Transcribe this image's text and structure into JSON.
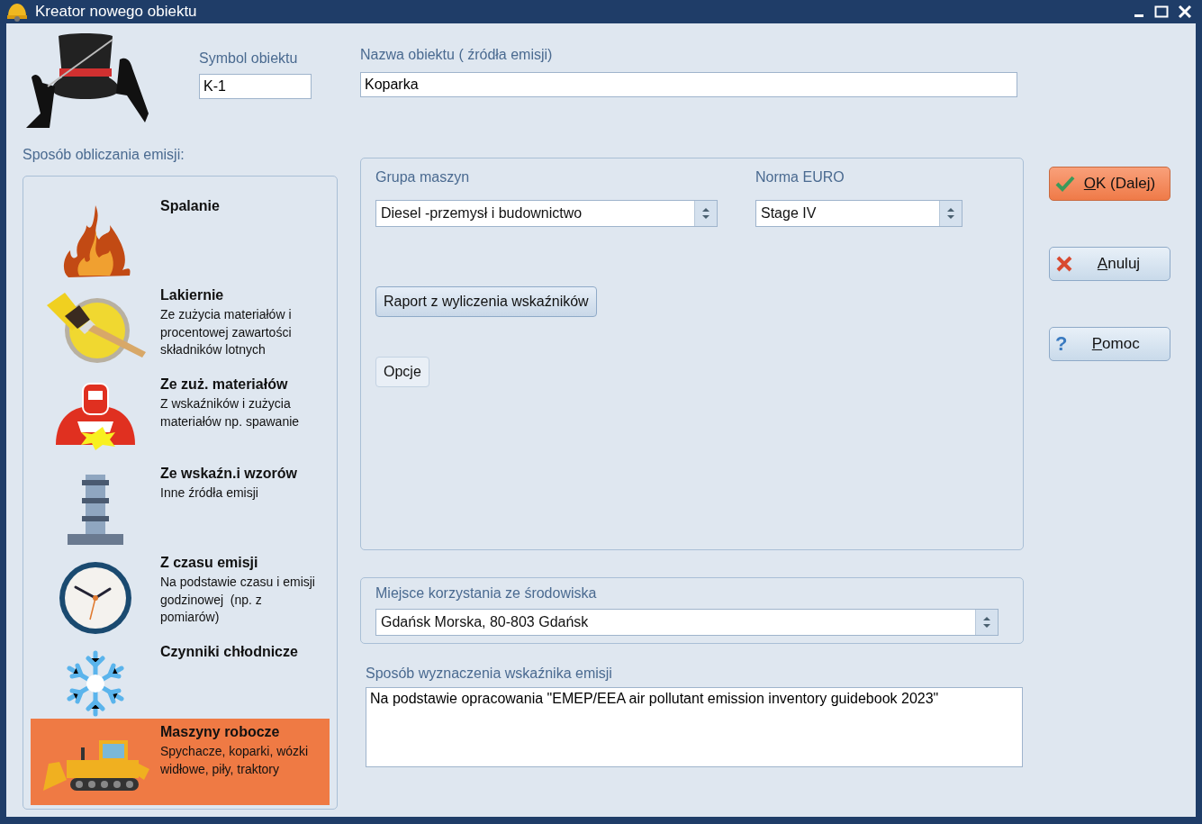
{
  "window": {
    "title": "Kreator nowego obiektu"
  },
  "symbol_field": {
    "label": "Symbol obiektu",
    "value": "K-1"
  },
  "name_field": {
    "label": "Nazwa obiektu ( źródła emisji)",
    "value": "Koparka"
  },
  "methods_label": "Sposób obliczania emisji:",
  "methods": [
    {
      "kind": "flame",
      "title": "Spalanie",
      "selected": false
    },
    {
      "kind": "brush",
      "title": "Lakiernie",
      "description": "Ze zużycia materiałów i procentowej zawartości składników lotnych",
      "selected": false
    },
    {
      "kind": "welder",
      "title": "Ze zuż. materiałów",
      "description": "Z wskaźników i zużycia materiałów np. spawanie",
      "selected": false
    },
    {
      "kind": "tower",
      "title": "Ze wskaźn.i wzorów",
      "description": "Inne źródła emisji",
      "selected": false
    },
    {
      "kind": "clock",
      "title": "Z czasu emisji",
      "description": "Na podstawie czasu i emisji godzinowej  (np. z pomiarów)",
      "selected": false
    },
    {
      "kind": "snowflake",
      "title": "Czynniki chłodnicze",
      "selected": false
    },
    {
      "kind": "bulldozer",
      "title": "Maszyny robocze",
      "description": "Spychacze, koparki, wózki widłowe, piły, traktory",
      "selected": true
    }
  ],
  "machine_panel": {
    "group": {
      "label": "Grupa maszyn",
      "value": "Diesel -przemysł i budownictwo"
    },
    "euro": {
      "label": "Norma EURO",
      "value": "Stage IV"
    },
    "report_button": "Raport z wyliczenia wskaźników",
    "options_button": "Opcje"
  },
  "location": {
    "label": "Miejsce korzystania ze środowiska",
    "value": "Gdańsk Morska, 80-803 Gdańsk"
  },
  "factor_method": {
    "label": "Sposób wyznaczenia wskaźnika emisji",
    "value": "Na podstawie opracowania \"EMEP/EEA air pollutant emission inventory guidebook 2023\""
  },
  "buttons": [
    {
      "kind": "ok",
      "label": "OK (Dalej)",
      "first_letter_underlined": true,
      "focused": true
    },
    {
      "kind": "cancel",
      "label": "Anuluj",
      "first_letter_underlined": true,
      "focused": false
    },
    {
      "kind": "help",
      "glyph": "?",
      "label": "Pomoc",
      "first_letter_underlined": true,
      "focused": false
    }
  ]
}
